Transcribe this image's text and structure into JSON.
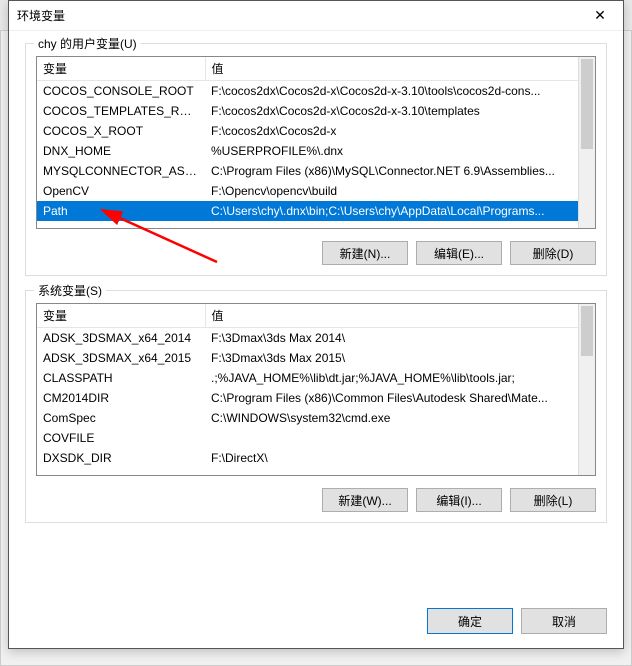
{
  "dialog": {
    "title": "环境变量",
    "close_glyph": "✕"
  },
  "user_group": {
    "label": "chy 的用户变量(U)",
    "columns": {
      "var": "变量",
      "val": "值"
    },
    "rows": [
      {
        "var": "COCOS_CONSOLE_ROOT",
        "val": "F:\\cocos2dx\\Cocos2d-x\\Cocos2d-x-3.10\\tools\\cocos2d-cons...",
        "selected": false
      },
      {
        "var": "COCOS_TEMPLATES_ROOT",
        "val": "F:\\cocos2dx\\Cocos2d-x\\Cocos2d-x-3.10\\templates",
        "selected": false
      },
      {
        "var": "COCOS_X_ROOT",
        "val": "F:\\cocos2dx\\Cocos2d-x",
        "selected": false
      },
      {
        "var": "DNX_HOME",
        "val": "%USERPROFILE%\\.dnx",
        "selected": false
      },
      {
        "var": "MYSQLCONNECTOR_ASS...",
        "val": "C:\\Program Files (x86)\\MySQL\\Connector.NET 6.9\\Assemblies...",
        "selected": false
      },
      {
        "var": "OpenCV",
        "val": "F:\\Opencv\\opencv\\build",
        "selected": false
      },
      {
        "var": "Path",
        "val": "C:\\Users\\chy\\.dnx\\bin;C:\\Users\\chy\\AppData\\Local\\Programs...",
        "selected": true
      }
    ],
    "buttons": {
      "new": "新建(N)...",
      "edit": "编辑(E)...",
      "delete": "删除(D)"
    }
  },
  "system_group": {
    "label": "系统变量(S)",
    "columns": {
      "var": "变量",
      "val": "值"
    },
    "rows": [
      {
        "var": "ADSK_3DSMAX_x64_2014",
        "val": "F:\\3Dmax\\3ds Max 2014\\"
      },
      {
        "var": "ADSK_3DSMAX_x64_2015",
        "val": "F:\\3Dmax\\3ds Max 2015\\"
      },
      {
        "var": "CLASSPATH",
        "val": ".;%JAVA_HOME%\\lib\\dt.jar;%JAVA_HOME%\\lib\\tools.jar;"
      },
      {
        "var": "CM2014DIR",
        "val": "C:\\Program Files (x86)\\Common Files\\Autodesk Shared\\Mate..."
      },
      {
        "var": "ComSpec",
        "val": "C:\\WINDOWS\\system32\\cmd.exe"
      },
      {
        "var": "COVFILE",
        "val": ""
      },
      {
        "var": "DXSDK_DIR",
        "val": "F:\\DirectX\\"
      }
    ],
    "buttons": {
      "new": "新建(W)...",
      "edit": "编辑(I)...",
      "delete": "删除(L)"
    }
  },
  "footer": {
    "ok": "确定",
    "cancel": "取消"
  }
}
